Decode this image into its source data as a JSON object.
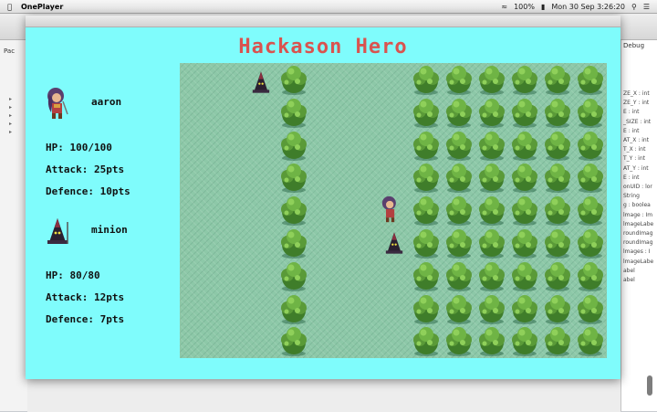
{
  "menubar": {
    "app_name": "OnePlayer",
    "battery": "100%",
    "clock": "Mon 30 Sep  3:26:20"
  },
  "ide": {
    "left_tab": "Pac",
    "right_tab": "Debug",
    "props": [
      "ZE_X : int",
      "ZE_Y : int",
      "E : int",
      "_SIZE : int",
      "E : int",
      "AT_X : int",
      "T_X : int",
      "T_Y : int",
      "AT_Y : int",
      "E : int",
      "onUID : lor",
      "String",
      "g : boolea",
      "lmage : Im",
      "lmageLabe",
      "roundImag",
      "roundImag",
      "lmages : I",
      "lmageLabe",
      "abel",
      "abel"
    ]
  },
  "game": {
    "title": "Hackason Hero",
    "hero": {
      "name": "aaron",
      "hp_label": "HP:",
      "hp": "100/100",
      "attack_label": "Attack:",
      "attack": "25pts",
      "defence_label": "Defence:",
      "defence": "10pts"
    },
    "enemy": {
      "name": "minion",
      "hp_label": "HP:",
      "hp": "80/80",
      "attack_label": "Attack:",
      "attack": "12pts",
      "defence_label": "Defence:",
      "defence": "7pts"
    }
  },
  "colors": {
    "window_bg": "#7ffcfc",
    "title": "#d9534f",
    "grass": "#8dc8a8",
    "tree_dark": "#3f7d2a",
    "tree_light": "#8fd05a"
  }
}
